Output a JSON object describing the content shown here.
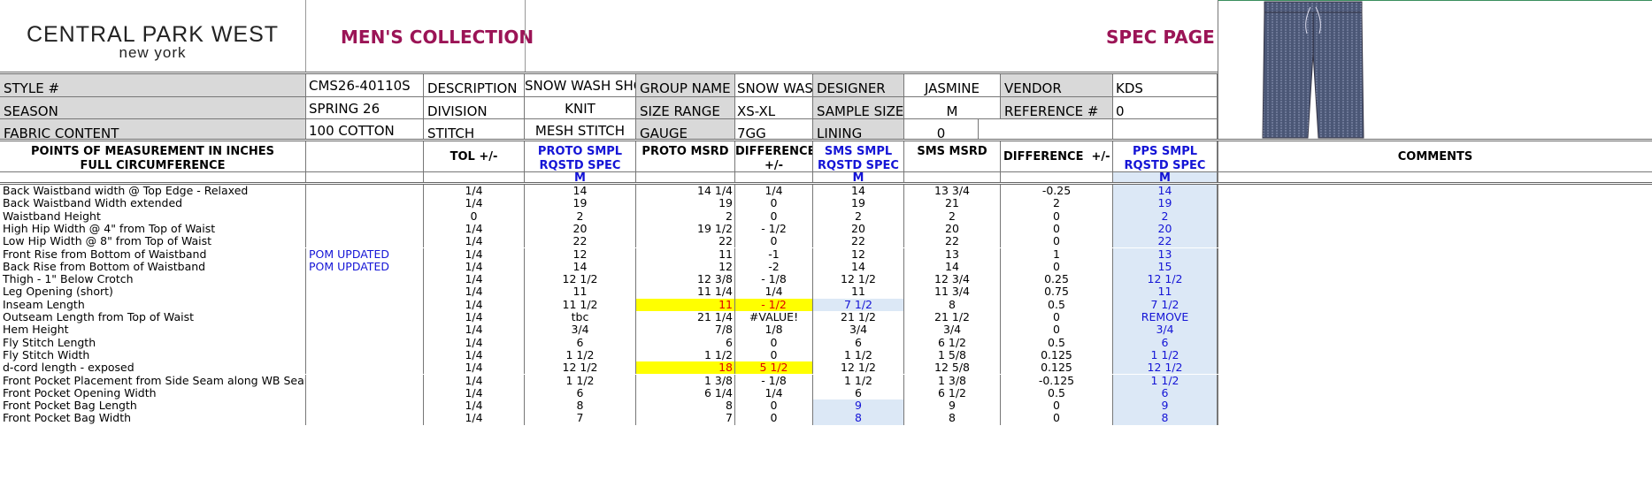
{
  "brand": {
    "line1": "CENTRAL PARK WEST",
    "line2": "new york"
  },
  "header": {
    "collection": "MEN'S COLLECTION",
    "page_title": "SPEC PAGE"
  },
  "info": {
    "style_label": "STYLE #",
    "style_value": "CMS26-40110S",
    "description_label": "DESCRIPTION",
    "description_value": "SNOW WASH SHORT",
    "group_label": "GROUP NAME",
    "group_value": "SNOW WASH",
    "designer_label": "DESIGNER",
    "designer_value": "JASMINE",
    "vendor_label": "VENDOR",
    "vendor_value": "KDS",
    "season_label": "SEASON",
    "season_value": "SPRING 26",
    "division_label": "DIVISION",
    "division_value": "KNIT",
    "size_range_label": "SIZE RANGE",
    "size_range_value": "XS-XL",
    "sample_size_label": "SAMPLE SIZE",
    "sample_size_value": "M",
    "reference_label": "REFERENCE #",
    "reference_value": "0",
    "fabric_label": "FABRIC CONTENT",
    "fabric_value": "100 COTTON",
    "stitch_label": "STITCH",
    "stitch_value": "MESH STITCH",
    "gauge_label": "GAUGE",
    "gauge_value": "7GG",
    "lining_label": "LINING",
    "lining_value": "0"
  },
  "columns": {
    "pom": "POINTS OF MEASUREMENT IN INCHES\nFULL CIRCUMFERENCE",
    "tol": "TOL +/-",
    "proto_spec": "PROTO SMPL  RQSTD SPEC",
    "proto_msrd": "PROTO MSRD",
    "diff1": "DIFFERENCE +/-",
    "sms_spec": "SMS SMPL RQSTD SPEC",
    "sms_msrd": "SMS MSRD",
    "diff2": "DIFFERENCE",
    "diff2_pm": "+/-",
    "pps_spec": "PPS SMPL RQSTD SPEC",
    "comments": "COMMENTS"
  },
  "size_labels": {
    "proto": "M",
    "sms": "M",
    "pps": "M"
  },
  "rows": [
    {
      "pom": "Back Waistband width @ Top Edge - Relaxed",
      "note": "",
      "tol": "1/4",
      "proto_spec": "14",
      "proto_msrd": "14 1/4",
      "diff1": "1/4",
      "sms_spec": "14",
      "sms_msrd": "13 3/4",
      "diff2": "-0.25",
      "pps_spec": "14"
    },
    {
      "pom": "Back Waistband Width extended",
      "note": "",
      "tol": "1/4",
      "proto_spec": "19",
      "proto_msrd": "19",
      "diff1": "0",
      "sms_spec": "19",
      "sms_msrd": "21",
      "diff2": "2",
      "pps_spec": "19"
    },
    {
      "pom": "Waistband Height",
      "note": "",
      "tol": "0",
      "proto_spec": "2",
      "proto_msrd": "2",
      "diff1": "0",
      "sms_spec": "2",
      "sms_msrd": "2",
      "diff2": "0",
      "pps_spec": "2"
    },
    {
      "pom": "High Hip Width @ 4\" from Top of Waist",
      "note": "",
      "tol": "1/4",
      "proto_spec": "20",
      "proto_msrd": "19 1/2",
      "diff1": "- 1/2",
      "sms_spec": "20",
      "sms_msrd": "20",
      "diff2": "0",
      "pps_spec": "20"
    },
    {
      "pom": "Low Hip Width @ 8\" from Top of Waist",
      "note": "",
      "tol": "1/4",
      "proto_spec": "22",
      "proto_msrd": "22",
      "diff1": "0",
      "sms_spec": "22",
      "sms_msrd": "22",
      "diff2": "0",
      "pps_spec": "22"
    },
    {
      "pom": "Front Rise from Bottom of Waistband",
      "note": "POM UPDATED",
      "tol": "1/4",
      "proto_spec": "12",
      "proto_msrd": "11",
      "diff1": "-1",
      "sms_spec": "12",
      "sms_msrd": "13",
      "diff2": "1",
      "pps_spec": "13"
    },
    {
      "pom": "Back Rise from Bottom of Waistband",
      "note": "POM UPDATED",
      "tol": "1/4",
      "proto_spec": "14",
      "proto_msrd": "12",
      "diff1": "-2",
      "sms_spec": "14",
      "sms_msrd": "14",
      "diff2": "0",
      "pps_spec": "15"
    },
    {
      "pom": "Thigh - 1\" Below Crotch",
      "note": "",
      "tol": "1/4",
      "proto_spec": "12 1/2",
      "proto_msrd": "12 3/8",
      "diff1": "- 1/8",
      "sms_spec": "12 1/2",
      "sms_msrd": "12 3/4",
      "diff2": "0.25",
      "pps_spec": "12 1/2"
    },
    {
      "pom": "Leg Opening (short)",
      "note": "",
      "tol": "1/4",
      "proto_spec": "11",
      "proto_msrd": "11 1/4",
      "diff1": "1/4",
      "sms_spec": "11",
      "sms_msrd": "11 3/4",
      "diff2": "0.75",
      "pps_spec": "11"
    },
    {
      "pom": "Inseam Length",
      "note": "",
      "tol": "1/4",
      "proto_spec": "11 1/2",
      "proto_msrd": "11",
      "diff1": "- 1/2",
      "sms_spec": "7 1/2",
      "sms_msrd": "8",
      "diff2": "0.5",
      "pps_spec": "7 1/2",
      "hl_proto": true,
      "hl_sms": true
    },
    {
      "pom": "Outseam Length from Top of Waist",
      "note": "",
      "tol": "1/4",
      "proto_spec": "tbc",
      "proto_msrd": "21 1/4",
      "diff1": "#VALUE!",
      "sms_spec": "21 1/2",
      "sms_msrd": "21 1/2",
      "diff2": "0",
      "pps_spec": "REMOVE"
    },
    {
      "pom": "Hem Height",
      "note": "",
      "tol": "1/4",
      "proto_spec": "3/4",
      "proto_msrd": "7/8",
      "diff1": "1/8",
      "sms_spec": "3/4",
      "sms_msrd": "3/4",
      "diff2": "0",
      "pps_spec": "3/4"
    },
    {
      "pom": "Fly Stitch Length",
      "note": "",
      "tol": "1/4",
      "proto_spec": "6",
      "proto_msrd": "6",
      "diff1": "0",
      "sms_spec": "6",
      "sms_msrd": "6 1/2",
      "diff2": "0.5",
      "pps_spec": "6"
    },
    {
      "pom": "Fly Stitch Width",
      "note": "",
      "tol": "1/4",
      "proto_spec": "1 1/2",
      "proto_msrd": "1 1/2",
      "diff1": "0",
      "sms_spec": "1 1/2",
      "sms_msrd": "1 5/8",
      "diff2": "0.125",
      "pps_spec": "1 1/2"
    },
    {
      "pom": "d-cord length - exposed",
      "note": "",
      "tol": "1/4",
      "proto_spec": "12 1/2",
      "proto_msrd": "18",
      "diff1": "5 1/2",
      "sms_spec": "12 1/2",
      "sms_msrd": "12 5/8",
      "diff2": "0.125",
      "pps_spec": "12 1/2",
      "hl_proto": true
    },
    {
      "pom": "Front Pocket Placement from Side Seam along WB Seam",
      "note": "",
      "tol": "1/4",
      "proto_spec": "1 1/2",
      "proto_msrd": "1 3/8",
      "diff1": "- 1/8",
      "sms_spec": "1 1/2",
      "sms_msrd": "1 3/8",
      "diff2": "-0.125",
      "pps_spec": "1 1/2"
    },
    {
      "pom": "Front Pocket Opening Width",
      "note": "",
      "tol": "1/4",
      "proto_spec": "6",
      "proto_msrd": "6 1/4",
      "diff1": "1/4",
      "sms_spec": "6",
      "sms_msrd": "6 1/2",
      "diff2": "0.5",
      "pps_spec": "6"
    },
    {
      "pom": "Front Pocket Bag Length",
      "note": "",
      "tol": "1/4",
      "proto_spec": "8",
      "proto_msrd": "8",
      "diff1": "0",
      "sms_spec": "9",
      "sms_msrd": "9",
      "diff2": "0",
      "pps_spec": "9",
      "hl_sms_blue": true
    },
    {
      "pom": "Front Pocket Bag Width",
      "note": "",
      "tol": "1/4",
      "proto_spec": "7",
      "proto_msrd": "7",
      "diff1": "0",
      "sms_spec": "8",
      "sms_msrd": "8",
      "diff2": "0",
      "pps_spec": "8",
      "hl_sms_blue": true
    }
  ],
  "colors": {
    "brand_accent": "#9b1456",
    "spec_blue": "#1414d6",
    "highlight_yellow": "#ffff00",
    "highlight_red": "#e00000",
    "pps_fill": "#dce8f6"
  },
  "image": {
    "icon": "garment-flat-sketch-shorts"
  }
}
